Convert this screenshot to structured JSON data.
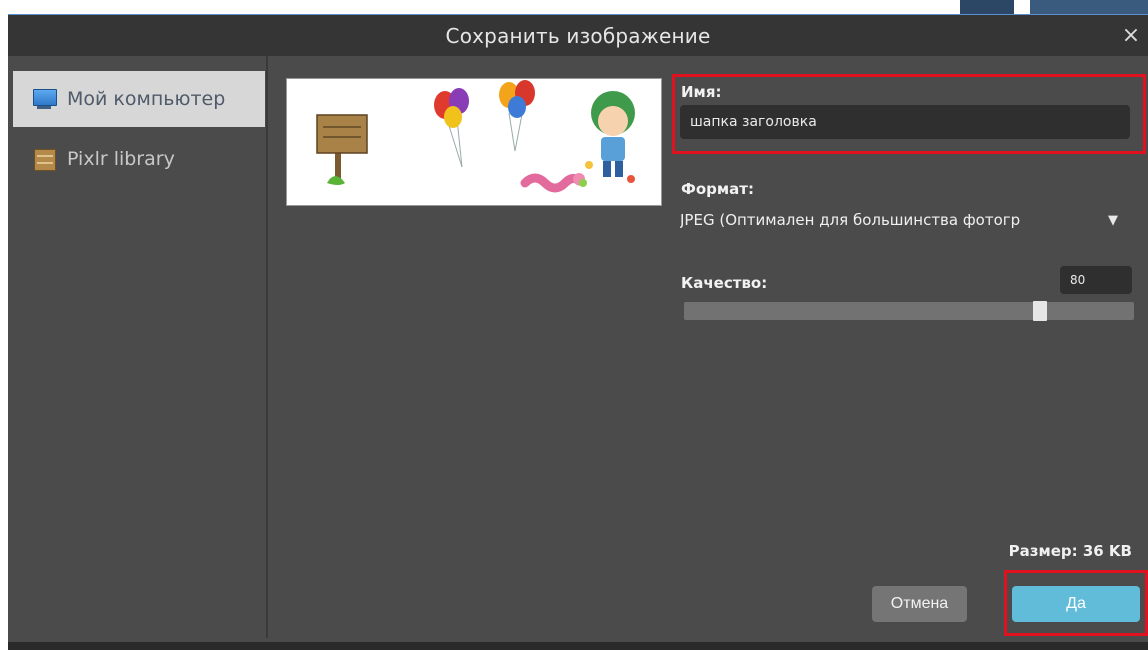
{
  "dialog": {
    "title": "Сохранить изображение",
    "close_label": "×"
  },
  "sidebar": {
    "items": [
      {
        "label": "Мой компьютер",
        "icon": "monitor-icon",
        "active": true
      },
      {
        "label": "Pixlr library",
        "icon": "library-icon",
        "active": false
      }
    ]
  },
  "form": {
    "name_label": "Имя:",
    "name_value": "шапка заголовка",
    "format_label": "Формат:",
    "format_value": "JPEG (Оптимален для большинства фотогр",
    "quality_label": "Качество:",
    "quality_value": "80",
    "quality_level": 0.8,
    "size_text": "Размер: 36 KB"
  },
  "buttons": {
    "cancel": "Отмена",
    "ok": "Да"
  },
  "colors": {
    "dialog_bg": "#4b4b4b",
    "titlebar_bg": "#353535",
    "accent": "#60bcd9",
    "highlight": "#e0121f"
  }
}
